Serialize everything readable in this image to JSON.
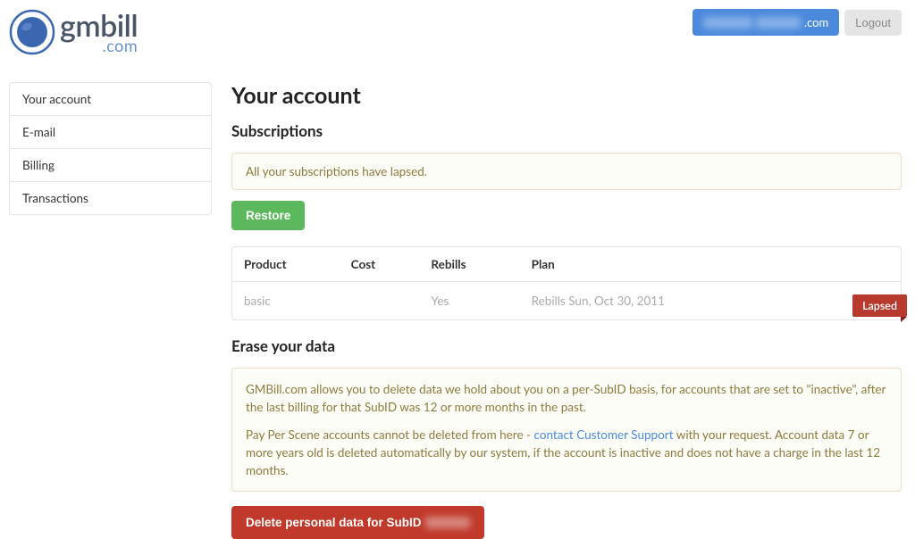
{
  "logo": {
    "main": "gmbill",
    "sub": ".com"
  },
  "header": {
    "user_domain_suffix": ".com",
    "logout": "Logout"
  },
  "sidebar": {
    "items": [
      {
        "label": "Your account"
      },
      {
        "label": "E-mail"
      },
      {
        "label": "Billing"
      },
      {
        "label": "Transactions"
      }
    ]
  },
  "page": {
    "title": "Your account",
    "subscriptions_heading": "Subscriptions",
    "lapsed_notice": "All your subscriptions have lapsed.",
    "restore_label": "Restore",
    "table": {
      "headers": {
        "product": "Product",
        "cost": "Cost",
        "rebills": "Rebills",
        "plan": "Plan"
      },
      "rows": [
        {
          "product": "basic",
          "cost": "",
          "rebills": "Yes",
          "plan": "Rebills Sun, Oct 30, 2011"
        }
      ]
    },
    "lapsed_badge": "Lapsed",
    "erase_heading": "Erase your data",
    "erase_p1": "GMBill.com allows you to delete data we hold about you on a per-SubID basis, for accounts that are set to \"inactive\", after the last billing for that SubID was 12 or more months in the past.",
    "erase_p2a": "Pay Per Scene accounts cannot be deleted from here - ",
    "erase_link": "contact Customer Support",
    "erase_p2b": " with your request. Account data 7 or more years old is deleted automatically by our system, if the account is inactive and does not have a charge in the last 12 months.",
    "delete_btn_prefix": "Delete personal data for SubID "
  }
}
